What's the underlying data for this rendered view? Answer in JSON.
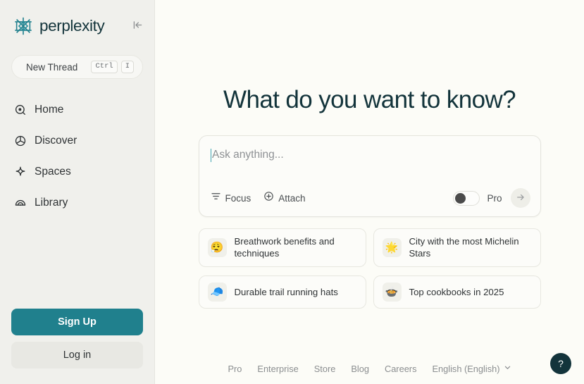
{
  "sidebar": {
    "brand": {
      "name": "perplexity",
      "logo_icon": "perplexity-starburst-icon"
    },
    "collapse_icon": "sidebar-collapse-icon",
    "new_thread": {
      "label": "New Thread",
      "shortcut_modifier": "Ctrl",
      "shortcut_key": "I"
    },
    "nav": [
      {
        "label": "Home",
        "icon": "home-target-icon"
      },
      {
        "label": "Discover",
        "icon": "globe-icon"
      },
      {
        "label": "Spaces",
        "icon": "sparkle-icon"
      },
      {
        "label": "Library",
        "icon": "library-arc-icon"
      }
    ],
    "auth": {
      "signup_label": "Sign Up",
      "login_label": "Log in"
    }
  },
  "main": {
    "headline": "What do you want to know?",
    "composer": {
      "placeholder": "Ask anything...",
      "focus_label": "Focus",
      "focus_icon": "filter-icon",
      "attach_label": "Attach",
      "attach_icon": "plus-circle-icon",
      "pro_label": "Pro",
      "pro_enabled": false,
      "submit_icon": "arrow-right-icon"
    },
    "suggestions": [
      {
        "emoji": "😮‍💨",
        "text": "Breathwork benefits and techniques"
      },
      {
        "emoji": "🌟",
        "text": "City with the most Michelin Stars"
      },
      {
        "emoji": "🧢",
        "text": "Durable trail running hats"
      },
      {
        "emoji": "🍲",
        "text": "Top cookbooks in 2025"
      }
    ],
    "footer": {
      "links": [
        "Pro",
        "Enterprise",
        "Store",
        "Blog",
        "Careers"
      ],
      "language": "English (English)",
      "language_chevron": "chevron-down-icon"
    },
    "help_label": "?"
  },
  "colors": {
    "brand_teal": "#20808d",
    "dark_teal": "#13343b",
    "sidebar_bg": "#f0f0ec",
    "main_bg": "#fcfcf7",
    "caret": "#3fa3b0"
  }
}
